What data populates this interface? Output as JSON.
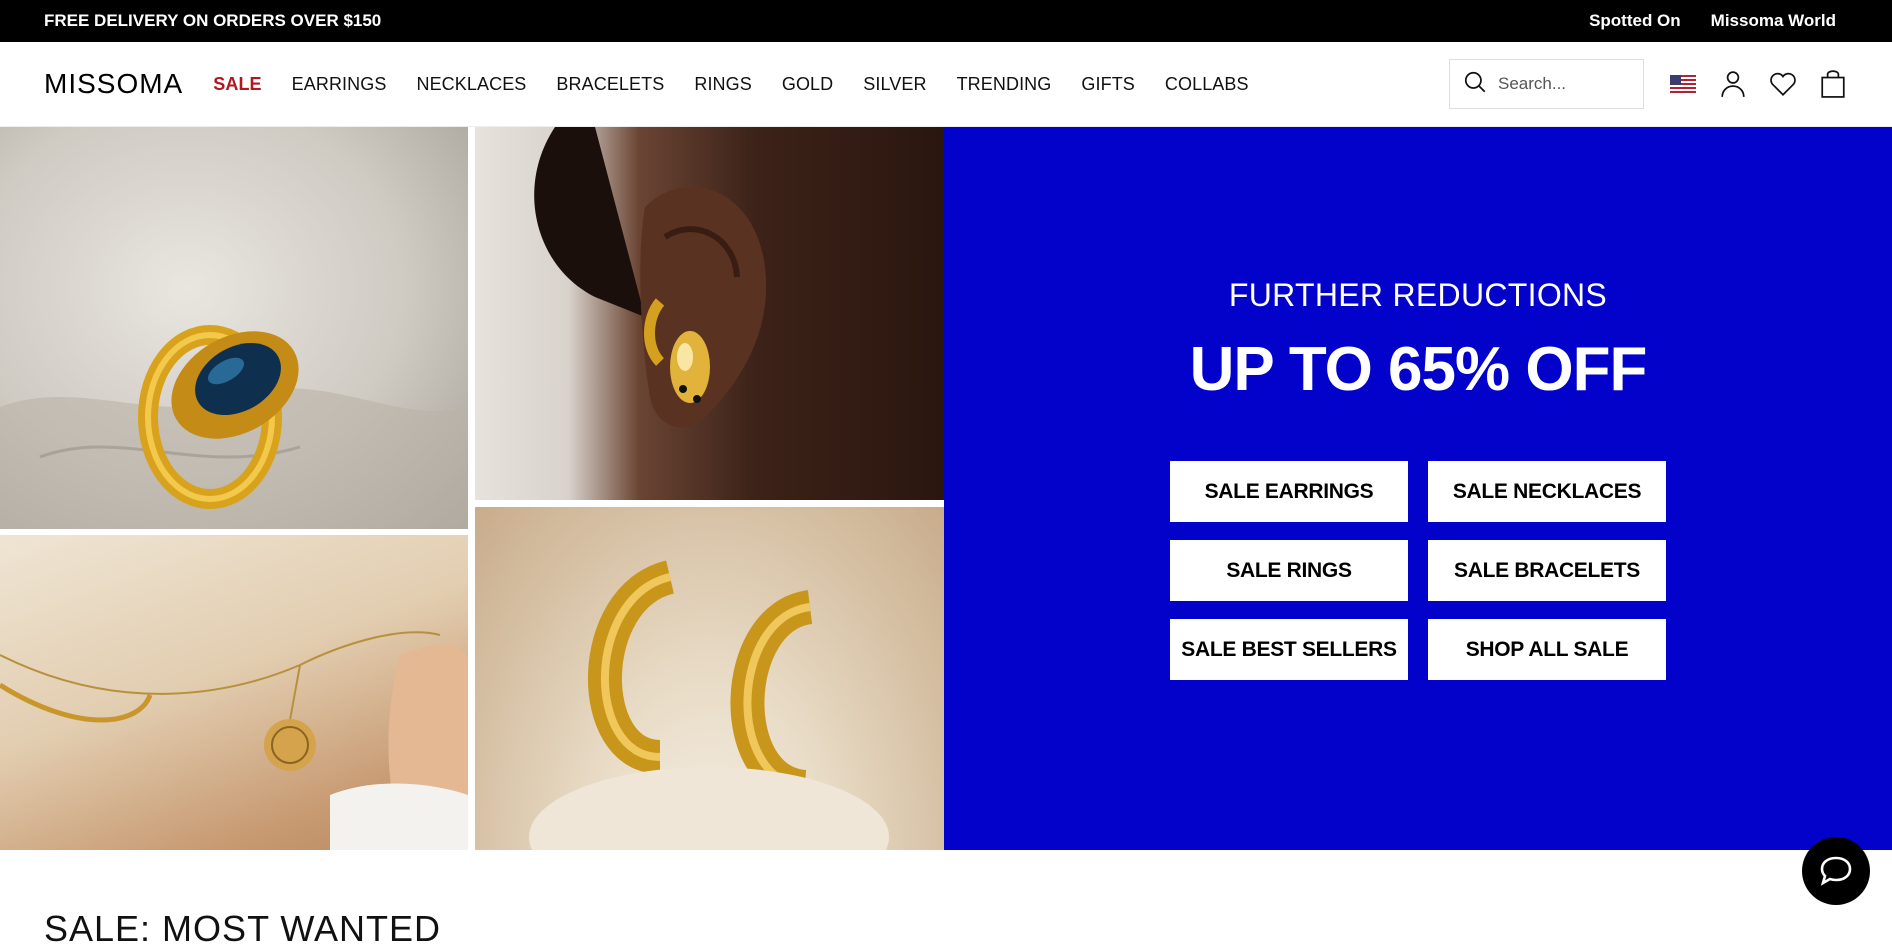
{
  "topbar": {
    "promo": "FREE DELIVERY ON ORDERS OVER $150",
    "links": [
      "Spotted On",
      "Missoma World"
    ]
  },
  "header": {
    "logo": "MISSOMA",
    "nav": [
      "SALE",
      "EARRINGS",
      "NECKLACES",
      "BRACELETS",
      "RINGS",
      "GOLD",
      "SILVER",
      "TRENDING",
      "GIFTS",
      "COLLABS"
    ],
    "search_placeholder": "Search...",
    "icons": [
      "us-flag-icon",
      "account-icon",
      "wishlist-heart-icon",
      "shopping-bag-icon"
    ]
  },
  "promo": {
    "subheading": "FURTHER REDUCTIONS",
    "headline": "UP TO 65% OFF",
    "buttons": [
      "SALE EARRINGS",
      "SALE NECKLACES",
      "SALE RINGS",
      "SALE BRACELETS",
      "SALE BEST SELLERS",
      "SHOP ALL SALE"
    ],
    "background_color": "#0202cb"
  },
  "next_section": {
    "heading": "SALE: MOST WANTED"
  },
  "colors": {
    "sale_nav": "#b0171f",
    "topbar_bg": "#000000"
  }
}
